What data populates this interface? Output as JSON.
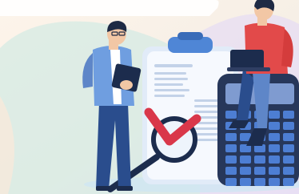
{
  "illustration": {
    "subject": "checklist-with-people-and-calculator",
    "icons": [
      "clipboard-icon",
      "checkmark-icon",
      "magnifier-icon",
      "calculator-icon",
      "laptop-icon",
      "tablet-icon"
    ],
    "colors": {
      "card_background": "#fbf0e4",
      "mint_wash": "#c9e9e4",
      "lilac_wash": "#e9def3",
      "ground_shadow": "#cfe6f2",
      "clipboard_light": "#f3f7fd",
      "clipboard_clip": "#4f86d6",
      "document_lines": "#c3d2e8",
      "check_red": "#d9374a",
      "magnifier_dark": "#1c2c4d",
      "calculator_body": "#27375a",
      "calculator_keys": "#4d7ed3",
      "calculator_screen": "#7f9bd0",
      "shirt_blue": "#6f9ee0",
      "shirt_red": "#e24a4a",
      "jeans_dark": "#2a4d8d",
      "jeans_light": "#5e86c8",
      "hair_dark": "#1e2a44",
      "skin": "#f2c7a5"
    }
  }
}
